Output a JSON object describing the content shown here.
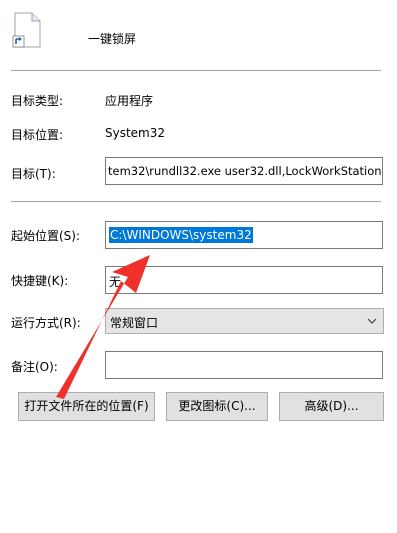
{
  "header": {
    "app_name": "一键锁屏",
    "icon": "shortcut-file-icon"
  },
  "fields": {
    "target_type_label": "目标类型:",
    "target_type_value": "应用程序",
    "target_location_label": "目标位置:",
    "target_location_value": "System32",
    "target_label": "目标(T):",
    "target_value": "tem32\\rundll32.exe user32.dll,LockWorkStation",
    "start_in_label": "起始位置(S):",
    "start_in_value": "C:\\WINDOWS\\system32",
    "shortcut_key_label": "快捷键(K):",
    "shortcut_key_value": "无",
    "run_label": "运行方式(R):",
    "run_value": "常规窗口",
    "comment_label": "备注(O):",
    "comment_value": ""
  },
  "buttons": {
    "open_location": "打开文件所在的位置(F)",
    "change_icon": "更改图标(C)...",
    "advanced": "高级(D)..."
  },
  "colors": {
    "selection": "#0078d7",
    "annotation_arrow": "#f0302a"
  }
}
